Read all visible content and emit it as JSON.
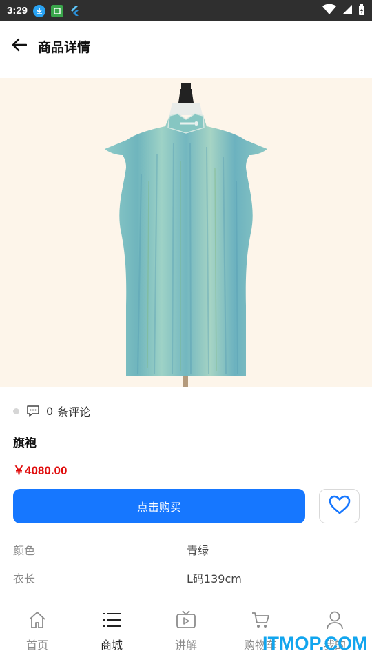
{
  "status_bar": {
    "time": "3:29"
  },
  "header": {
    "title": "商品详情"
  },
  "product": {
    "comments_count": "0",
    "comments_suffix": "条评论",
    "name": "旗袍",
    "price": "￥4080.00",
    "buy_label": "点击购买",
    "specs": [
      {
        "label": "颜色",
        "value": "青绿"
      },
      {
        "label": "衣长",
        "value": "L码139cm"
      }
    ]
  },
  "tab_bar": {
    "items": [
      {
        "label": "首页",
        "icon": "home-icon",
        "active": false
      },
      {
        "label": "商城",
        "icon": "list-icon",
        "active": true
      },
      {
        "label": "讲解",
        "icon": "tv-play-icon",
        "active": false
      },
      {
        "label": "购物车",
        "icon": "cart-icon",
        "active": false
      },
      {
        "label": "我的",
        "icon": "user-icon",
        "active": false
      }
    ]
  },
  "watermark": "ITMOP.COM",
  "colors": {
    "accent": "#1677ff",
    "price": "#e00b0b",
    "hero_bg": "#fdf5ea",
    "dress": "#7cc3c4"
  }
}
